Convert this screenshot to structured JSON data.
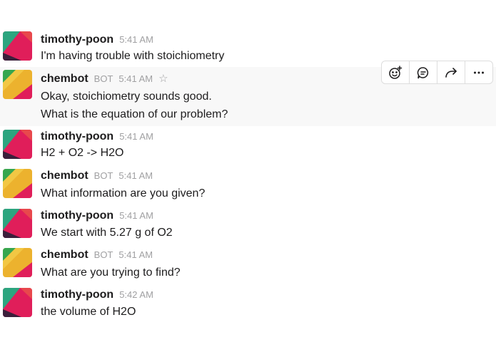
{
  "bot_badge": "BOT",
  "star_glyph": "☆",
  "colors": {
    "avatar_timothy": [
      "#2ca57f",
      "#e01e5a",
      "#3b1f3b",
      "#e8484c"
    ],
    "avatar_chembot": [
      "#ecb22e",
      "#36a64f",
      "#e01e5a",
      "#f2c744"
    ]
  },
  "messages": [
    {
      "user": "timothy-poon",
      "time": "5:41 AM",
      "lines": [
        "I'm having trouble with stoichiometry"
      ]
    },
    {
      "user": "chembot",
      "time": "5:41 AM",
      "lines": [
        "Okay, stoichiometry sounds good.",
        "What is the equation of our problem?"
      ]
    },
    {
      "user": "timothy-poon",
      "time": "5:41 AM",
      "lines": [
        "H2 + O2 -> H2O"
      ]
    },
    {
      "user": "chembot",
      "time": "5:41 AM",
      "lines": [
        "What information are you given?"
      ]
    },
    {
      "user": "timothy-poon",
      "time": "5:41 AM",
      "lines": [
        "We start with 5.27 g of O2"
      ]
    },
    {
      "user": "chembot",
      "time": "5:41 AM",
      "lines": [
        "What are you trying to find?"
      ]
    },
    {
      "user": "timothy-poon",
      "time": "5:42 AM",
      "lines": [
        "the volume of H2O"
      ]
    }
  ],
  "message_actions": [
    "add-reaction-icon",
    "reply-thread-icon",
    "share-message-icon",
    "more-actions-icon"
  ]
}
